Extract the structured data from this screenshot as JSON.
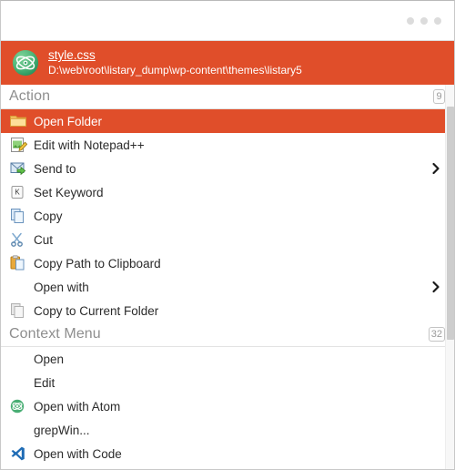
{
  "window": {
    "overflow_dots_label": "•••"
  },
  "colors": {
    "accent": "#e04e2a",
    "section_text": "#8e8e8e",
    "row_text": "#2b2b2b",
    "badge_border": "#c4c4c4",
    "scroll_thumb": "#cdcdcd",
    "dot": "#dcdcdc"
  },
  "file_header": {
    "icon": "atom-icon",
    "name": "style.css",
    "path": "D:\\web\\root\\listary_dump\\wp-content\\themes\\listary5"
  },
  "sections": [
    {
      "title": "Action",
      "count": "9",
      "items": [
        {
          "label": "Open Folder",
          "icon": "folder-icon",
          "selected": true,
          "submenu": false
        },
        {
          "label": "Edit with Notepad++",
          "icon": "notepad-plus-icon",
          "selected": false,
          "submenu": false
        },
        {
          "label": "Send to",
          "icon": "send-to-icon",
          "selected": false,
          "submenu": true
        },
        {
          "label": "Set Keyword",
          "icon": "keyboard-key-k-icon",
          "selected": false,
          "submenu": false
        },
        {
          "label": "Copy",
          "icon": "copy-icon",
          "selected": false,
          "submenu": false
        },
        {
          "label": "Cut",
          "icon": "scissors-icon",
          "selected": false,
          "submenu": false
        },
        {
          "label": "Copy Path to Clipboard",
          "icon": "clipboard-copy-icon",
          "selected": false,
          "submenu": false
        },
        {
          "label": "Open with",
          "icon": "none",
          "selected": false,
          "submenu": true
        },
        {
          "label": "Copy to Current Folder",
          "icon": "copy-gray-icon",
          "selected": false,
          "submenu": false
        }
      ]
    },
    {
      "title": "Context Menu",
      "count": "32",
      "items": [
        {
          "label": "Open",
          "icon": "none",
          "selected": false,
          "submenu": false
        },
        {
          "label": "Edit",
          "icon": "none",
          "selected": false,
          "submenu": false
        },
        {
          "label": "Open with Atom",
          "icon": "atom-small-icon",
          "selected": false,
          "submenu": false
        },
        {
          "label": "grepWin...",
          "icon": "none",
          "selected": false,
          "submenu": false
        },
        {
          "label": "Open with Code",
          "icon": "vscode-icon",
          "selected": false,
          "submenu": false
        }
      ]
    }
  ]
}
